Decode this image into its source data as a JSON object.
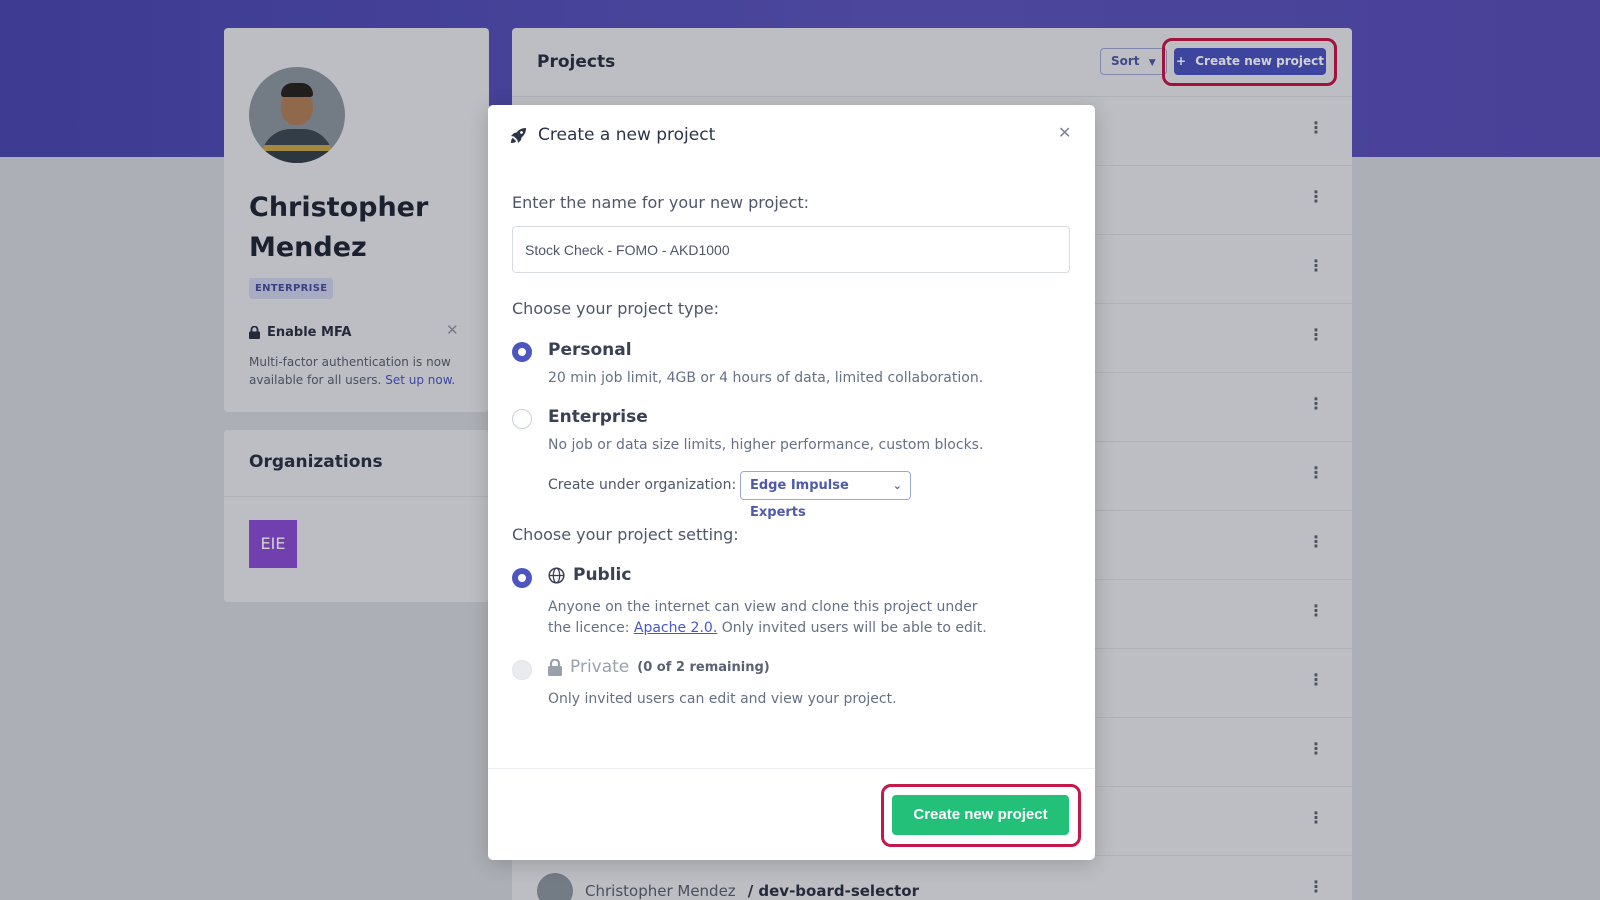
{
  "profile": {
    "name": "Christopher Mendez",
    "tier_badge": "ENTERPRISE",
    "mfa": {
      "title": "Enable MFA",
      "text": "Multi-factor authentication is now available for all users.",
      "link": "Set up now."
    }
  },
  "organizations": {
    "title": "Organizations",
    "tiles": [
      "EIE"
    ]
  },
  "projects": {
    "title": "Projects",
    "sort_label": "Sort",
    "create_label": "Create new project",
    "bottom_row": {
      "owner": "Christopher Mendez",
      "project": "/ dev-board-selector"
    }
  },
  "modal": {
    "title": "Create a new project",
    "name_label": "Enter the name for your new project:",
    "name_value": "Stock Check - FOMO - AKD1000",
    "type_label": "Choose your project type:",
    "types": [
      {
        "title": "Personal",
        "desc": "20 min job limit, 4GB or 4 hours of data, limited collaboration.",
        "selected": true
      },
      {
        "title": "Enterprise",
        "desc": "No job or data size limits, higher performance, custom blocks.",
        "selected": false
      }
    ],
    "org_label": "Create under organization:",
    "org_value": "Edge Impulse Experts",
    "setting_label": "Choose your project setting:",
    "settings": {
      "public": {
        "title": "Public",
        "desc_prefix": "Anyone on the internet can view and clone this project under the licence:",
        "license_link": "Apache 2.0.",
        "desc_suffix": "Only invited users will be able to edit.",
        "selected": true
      },
      "private": {
        "title": "Private",
        "remaining": "(0 of 2 remaining)",
        "desc": "Only invited users can edit and view your project.",
        "selected": false
      }
    },
    "submit_label": "Create new project"
  },
  "colors": {
    "header_band": "#4b48b3",
    "accent": "#4c55c2",
    "success": "#23c07a",
    "highlight_ring": "#c4194a"
  }
}
